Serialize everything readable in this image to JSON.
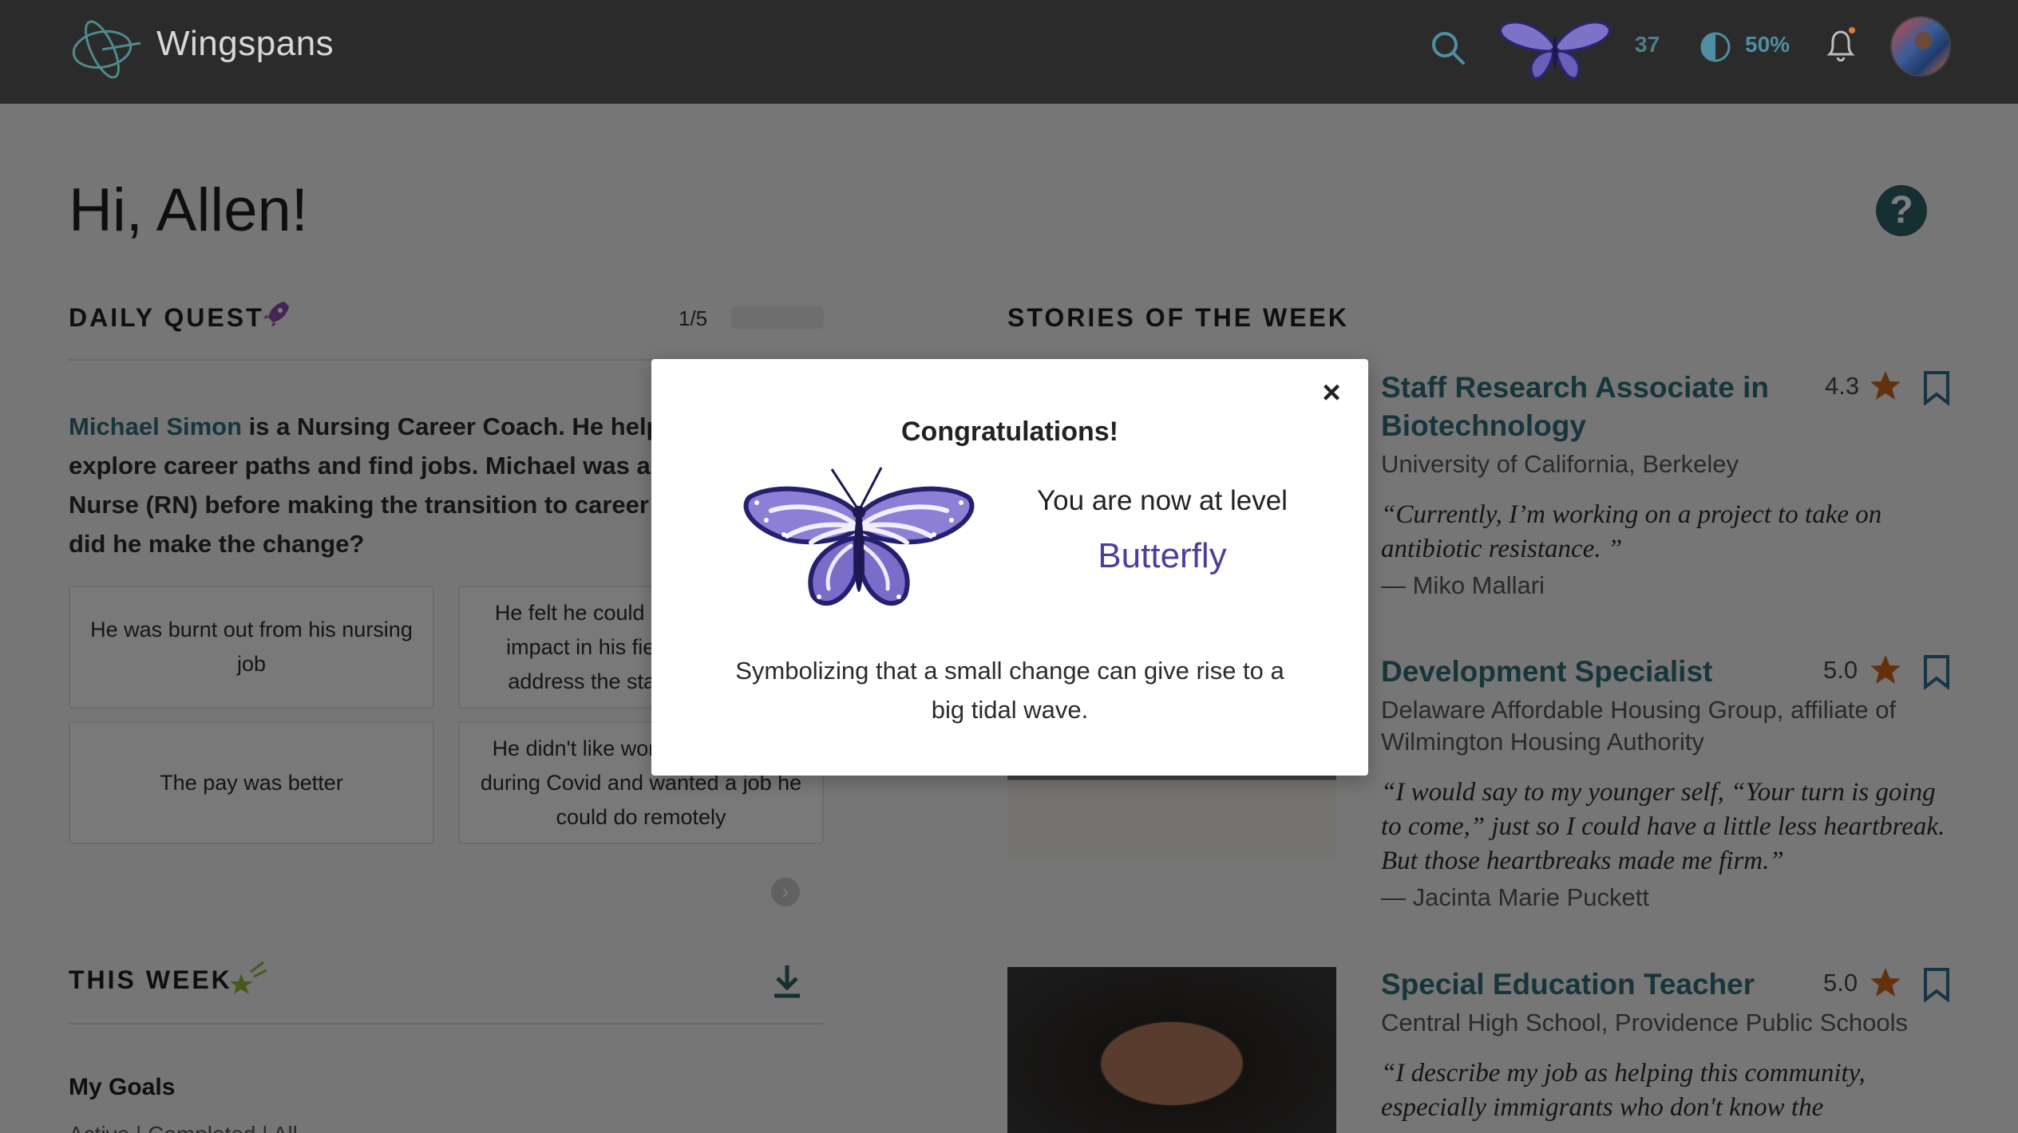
{
  "app": {
    "brand_name": "Wingspans",
    "points": "37",
    "contrast_percent": "50%",
    "accent_color": "#2f6a78",
    "level_color": "#4c3f9a"
  },
  "header": {
    "icons": [
      "logo-icon",
      "search-icon",
      "butterfly-level-icon",
      "contrast-icon",
      "bell-icon",
      "user-avatar"
    ]
  },
  "main": {
    "greeting": "Hi, Allen!",
    "help_icon": "?"
  },
  "daily_quest": {
    "title": "DAILY QUEST",
    "progress_text": "1/5",
    "progress_fraction": 0,
    "question_name": "Michael Simon",
    "question_rest": " is a Nursing Career Coach. He helps students explore career paths and find jobs. Michael was a Registered Nurse (RN) before making the transition to career coaching. Why did he make the change?",
    "answers": [
      "He was burnt out from his nursing job",
      "He felt he could make a bigger impact in his field if he could address the state of nursing",
      "The pay was better",
      "He didn't like working in person during Covid and wanted a job he could do remotely"
    ]
  },
  "this_week": {
    "title": "THIS WEEK",
    "goals_title": "My Goals",
    "goals_tabs": "Active  |  Completed  |  All"
  },
  "stories": {
    "title": "STORIES OF THE WEEK",
    "items": [
      {
        "title": "Staff Research Associate in Biotechnology",
        "org": "University of California, Berkeley",
        "quote": "“Currently, I’m working on a project to take on antibiotic resistance. ”",
        "author": "— Miko Mallari",
        "rating": "4.3"
      },
      {
        "title": "Development Specialist",
        "org": "Delaware Affordable Housing Group, affiliate of Wilmington Housing Authority",
        "quote": "“I would say to my younger self, “Your turn is going to come,” just so I could have a little less heartbreak. But those heartbreaks made me firm.”",
        "author": "— Jacinta Marie Puckett",
        "rating": "5.0"
      },
      {
        "title": "Special Education Teacher",
        "org": "Central High School, Providence Public Schools",
        "quote": "“I describe my job as helping this community, especially immigrants who don't know the",
        "author": "",
        "rating": "5.0"
      }
    ]
  },
  "modal": {
    "title": "Congratulations!",
    "level_text": "You are now at level",
    "level_name": "Butterfly",
    "description": "Symbolizing that a small change can give rise to a big tidal wave.",
    "close_label": "×"
  }
}
